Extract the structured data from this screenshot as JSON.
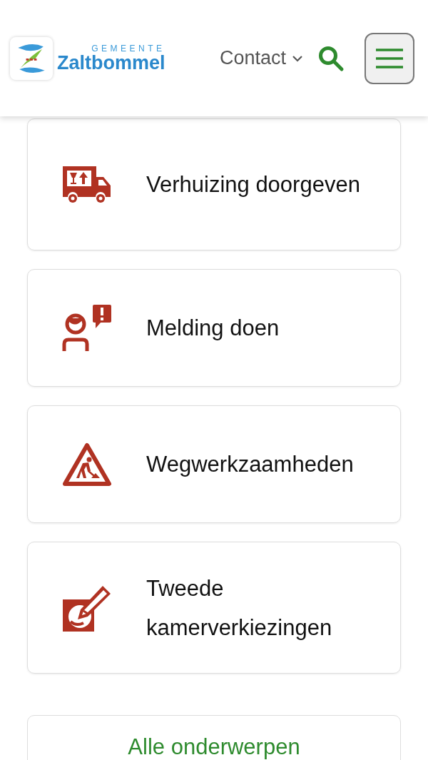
{
  "header": {
    "logo": {
      "prefix": "GEMEENTE",
      "name": "Zaltbommel"
    },
    "contact": "Contact"
  },
  "cards": [
    {
      "kind": "truck",
      "label": "Verhuizing doorgeven"
    },
    {
      "kind": "report",
      "label": "Melding doen"
    },
    {
      "kind": "roadwork",
      "label": "Wegwerkzaamheden"
    },
    {
      "kind": "vote",
      "label": "Tweede kamerverkiezingen"
    }
  ],
  "all_topics": "Alle onderwerpen"
}
